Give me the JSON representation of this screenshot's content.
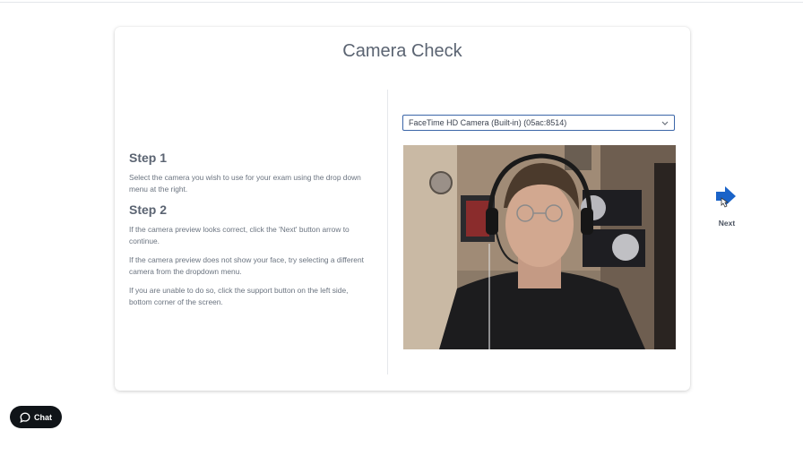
{
  "page": {
    "title": "Camera Check"
  },
  "steps": [
    {
      "heading": "Step 1",
      "paragraphs": [
        "Select the camera you wish to use for your exam using the drop down menu at the right."
      ]
    },
    {
      "heading": "Step 2",
      "paragraphs": [
        "If the camera preview looks correct, click the 'Next' button arrow to continue.",
        "If the camera preview does not show your face, try selecting a different camera from the dropdown menu.",
        "If you are unable to do so, click the support button on the left side, bottom corner of the screen."
      ]
    }
  ],
  "camera_select": {
    "selected": "FaceTime HD Camera (Built-in) (05ac:8514)"
  },
  "next": {
    "label": "Next"
  },
  "chat": {
    "label": "Chat"
  },
  "colors": {
    "accent": "#1a63c8",
    "chat_bg": "#101418",
    "select_border": "#3b66a8"
  },
  "icons": {
    "next": "arrow-right-icon",
    "chat": "chat-bubble-icon",
    "select": "chevron-down-icon"
  }
}
